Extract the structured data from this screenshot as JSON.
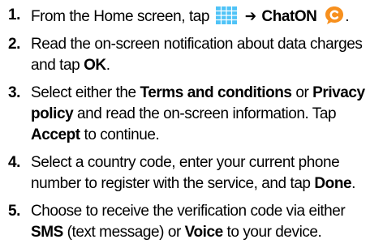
{
  "steps": [
    {
      "number": "1.",
      "t1": "From the Home screen, tap",
      "arrow": "➔",
      "b1": "ChatON",
      "t2": "."
    },
    {
      "number": "2.",
      "t1": "Read the on-screen notification about data charges and tap",
      "b1": "OK",
      "t2": "."
    },
    {
      "number": "3.",
      "t1": "Select either the",
      "b1": "Terms and conditions",
      "t2": " or ",
      "b2": "Privacy policy",
      "t3": " and read the on-screen information. Tap ",
      "b3": "Accept",
      "t4": " to continue."
    },
    {
      "number": "4.",
      "t1": "Select a country code, enter your current phone number to register with the service, and tap",
      "b1": "Done",
      "t2": "."
    },
    {
      "number": "5.",
      "t1": "Choose to receive the verification code via either",
      "b1": "SMS",
      "t2": " (text message) or ",
      "b2": "Voice",
      "t3": " to your device."
    }
  ],
  "icons": {
    "apps": "apps-grid-icon",
    "chaton": "chaton-icon"
  },
  "colors": {
    "apps_icon": "#4fc3f7",
    "chaton_orange": "#f7901e"
  }
}
